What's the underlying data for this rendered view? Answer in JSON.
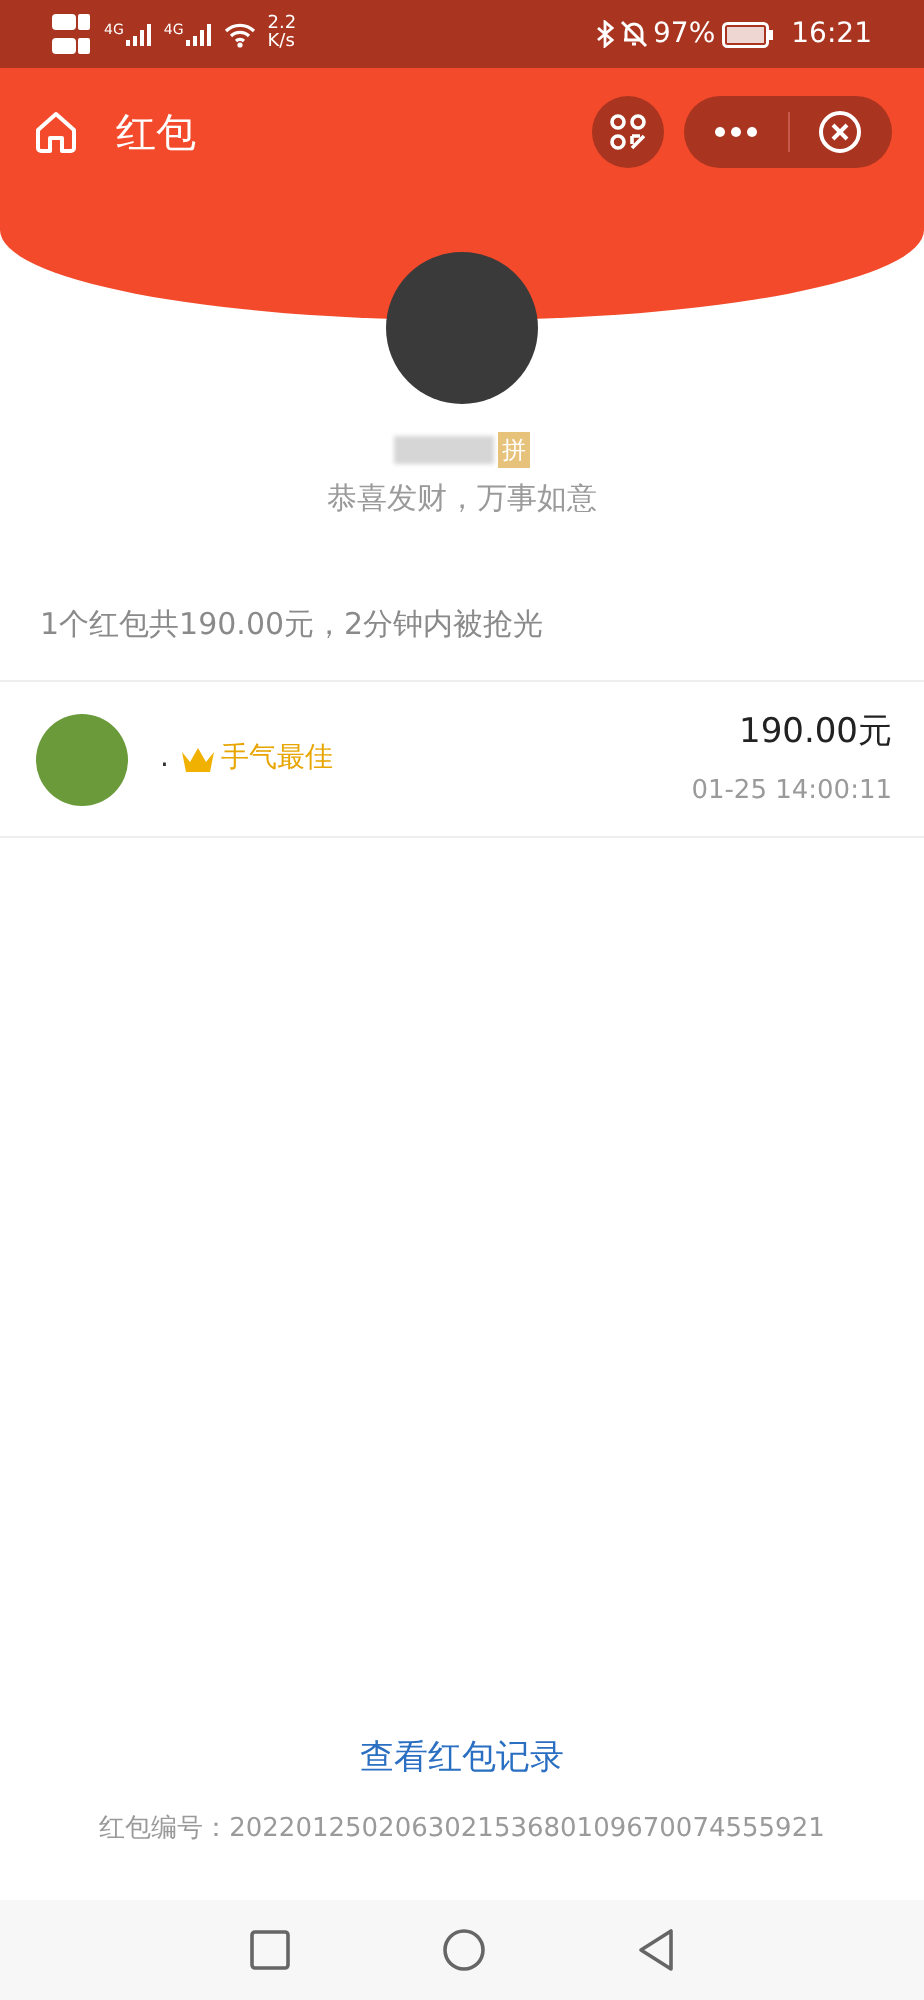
{
  "status_bar": {
    "network_speed": "2.2",
    "network_unit": "K/s",
    "signal_labels": [
      "4G",
      "4G"
    ],
    "battery": "97%",
    "time": "16:21"
  },
  "header": {
    "title": "红包"
  },
  "sender": {
    "badge": "拼",
    "greeting": "恭喜发财，万事如意"
  },
  "summary": "1个红包共190.00元，2分钟内被抢光",
  "records": [
    {
      "name": ".",
      "best": true,
      "best_label": "手气最佳",
      "amount": "190.00元",
      "time": "01-25 14:00:11"
    }
  ],
  "footer": {
    "link": "查看红包记录",
    "id_label": "红包编号：",
    "id": "202201250206302153680109670074555921"
  }
}
